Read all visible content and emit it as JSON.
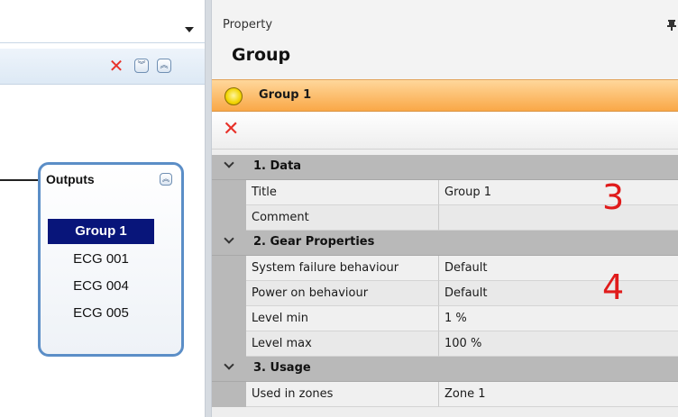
{
  "left_panel": {
    "outputs_node": {
      "title": "Outputs",
      "items": [
        "Group 1",
        "ECG 001",
        "ECG 004",
        "ECG 005"
      ],
      "selected_index": 0
    }
  },
  "property_panel": {
    "header_label": "Property",
    "title": "Group",
    "selected_object": "Group 1",
    "categories": [
      {
        "label": "1. Data",
        "rows": [
          {
            "name": "Title",
            "value": "Group 1"
          },
          {
            "name": "Comment",
            "value": ""
          }
        ]
      },
      {
        "label": "2. Gear Properties",
        "rows": [
          {
            "name": "System failure behaviour",
            "value": "Default"
          },
          {
            "name": "Power on behaviour",
            "value": "Default"
          },
          {
            "name": "Level min",
            "value": "1 %"
          },
          {
            "name": "Level max",
            "value": "100 %"
          }
        ]
      },
      {
        "label": "3. Usage",
        "rows": [
          {
            "name": "Used in zones",
            "value": "Zone 1"
          }
        ]
      }
    ]
  },
  "annotations": {
    "marker_3": "3",
    "marker_4": "4"
  },
  "colors": {
    "accent_orange": "#f9a847",
    "selection_navy": "#08157a",
    "delete_red": "#e8322a",
    "annotation_red": "#e01b1b",
    "node_border": "#5b8ec7"
  },
  "icons": {
    "dropdown": "chevron-down-icon",
    "close": "close-icon",
    "expand": "expand-all-icon",
    "collapse": "collapse-all-icon",
    "pin": "pin-icon",
    "bulb": "bulb-icon",
    "delete": "delete-icon"
  }
}
